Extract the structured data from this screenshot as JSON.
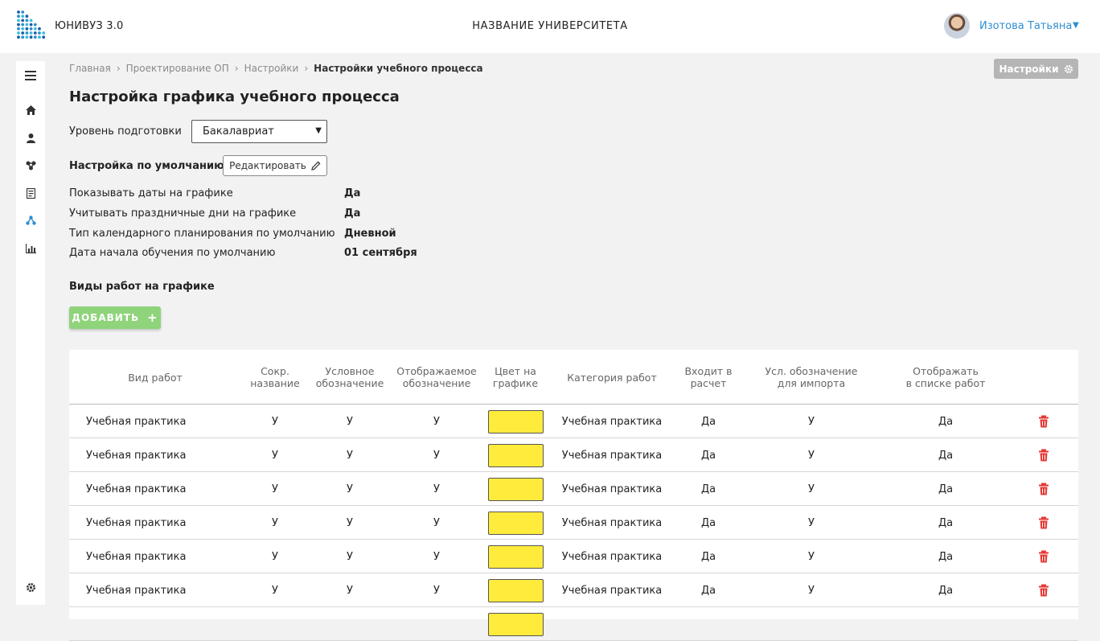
{
  "header": {
    "app_name": "ЮНИВУЗ 3.0",
    "university": "НАЗВАНИЕ УНИВЕРСИТЕТА",
    "user_name": "Изотова Татьяна",
    "user_caret": "▼",
    "logo_icon": "dot-grid-logo",
    "accent_color": "#2e8fcf"
  },
  "sidebar": {
    "items": [
      {
        "icon": "menu-icon"
      },
      {
        "icon": "home-icon"
      },
      {
        "icon": "user-icon"
      },
      {
        "icon": "network-icon"
      },
      {
        "icon": "document-icon"
      },
      {
        "icon": "hierarchy-icon",
        "active": true
      },
      {
        "icon": "bar-chart-icon"
      },
      {
        "icon": "gear-icon"
      }
    ]
  },
  "breadcrumb": {
    "items": [
      "Главная",
      "Проектирование ОП",
      "Настройки"
    ],
    "current": "Настройки учебного процесса",
    "separator": "›"
  },
  "settings_button": {
    "label": "Настройки",
    "icon": "gear-icon"
  },
  "page_title": "Настройка графика учебного процесса",
  "level": {
    "label": "Уровень подготовки",
    "value": "Бакалавриат"
  },
  "defaults": {
    "label": "Настройка по умолчанию",
    "edit_label": "Редактировать",
    "properties": [
      {
        "label": "Показывать даты на графике",
        "value": "Да"
      },
      {
        "label": "Учитывать праздничные дни на графике",
        "value": "Да"
      },
      {
        "label": "Тип календарного планирования по умолчанию",
        "value": "Дневной"
      },
      {
        "label": "Дата начала обучения по умолчанию",
        "value": "01 сентября"
      }
    ]
  },
  "work_types": {
    "label": "Виды работ на графике",
    "add_label": "ДОБАВИТЬ",
    "add_icon": "+",
    "add_color": "#8fd37b",
    "headers": [
      [
        "Вид работ"
      ],
      [
        "Сокр.",
        "название"
      ],
      [
        "Условное",
        "обозначение"
      ],
      [
        "Отображаемое",
        "обозначение"
      ],
      [
        "Цвет на",
        "графике"
      ],
      [
        "Категория работ"
      ],
      [
        "Входит в",
        "расчет"
      ],
      [
        "Усл. обозначение",
        "для импорта"
      ],
      [
        "Отображать",
        "в списке работ"
      ]
    ],
    "rows": [
      {
        "type": "Учебная практика",
        "short": "У",
        "symbol": "У",
        "display": "У",
        "color": "#ffeb3b",
        "category": "Учебная практика",
        "included": "Да",
        "import": "У",
        "show": "Да"
      },
      {
        "type": "Учебная практика",
        "short": "У",
        "symbol": "У",
        "display": "У",
        "color": "#ffeb3b",
        "category": "Учебная практика",
        "included": "Да",
        "import": "У",
        "show": "Да"
      },
      {
        "type": "Учебная практика",
        "short": "У",
        "symbol": "У",
        "display": "У",
        "color": "#ffeb3b",
        "category": "Учебная практика",
        "included": "Да",
        "import": "У",
        "show": "Да"
      },
      {
        "type": "Учебная практика",
        "short": "У",
        "symbol": "У",
        "display": "У",
        "color": "#ffeb3b",
        "category": "Учебная практика",
        "included": "Да",
        "import": "У",
        "show": "Да"
      },
      {
        "type": "Учебная практика",
        "short": "У",
        "symbol": "У",
        "display": "У",
        "color": "#ffeb3b",
        "category": "Учебная практика",
        "included": "Да",
        "import": "У",
        "show": "Да"
      },
      {
        "type": "Учебная практика",
        "short": "У",
        "symbol": "У",
        "display": "У",
        "color": "#ffeb3b",
        "category": "Учебная практика",
        "included": "Да",
        "import": "У",
        "show": "Да"
      },
      {
        "type": "",
        "short": "",
        "symbol": "",
        "display": "",
        "color": "#ffeb3b",
        "category": "",
        "included": "",
        "import": "",
        "show": ""
      }
    ],
    "delete_color": "#e53935"
  }
}
